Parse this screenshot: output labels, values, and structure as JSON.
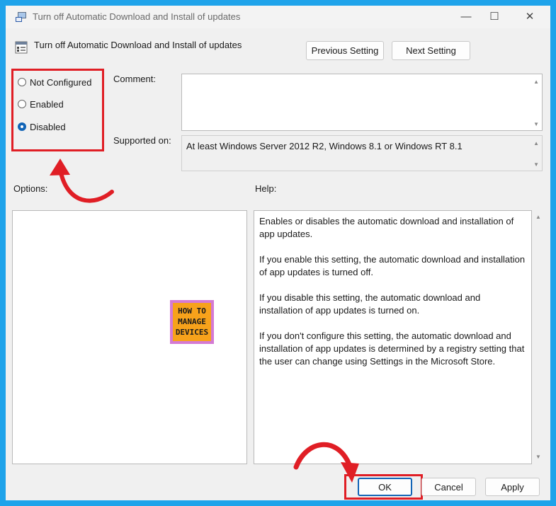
{
  "window": {
    "title": "Turn off Automatic Download and Install of updates",
    "controls": {
      "minimize": "—",
      "maximize": "☐",
      "close": "✕"
    }
  },
  "header": {
    "policy_name": "Turn off Automatic Download and Install of updates",
    "previous_label": "Previous Setting",
    "next_label": "Next Setting"
  },
  "state": {
    "options": [
      {
        "label": "Not Configured",
        "checked": false
      },
      {
        "label": "Enabled",
        "checked": false
      },
      {
        "label": "Disabled",
        "checked": true
      }
    ]
  },
  "comment": {
    "label": "Comment:",
    "value": ""
  },
  "supported": {
    "label": "Supported on:",
    "value": "At least Windows Server 2012 R2, Windows 8.1 or Windows RT 8.1"
  },
  "options_label": "Options:",
  "help": {
    "label": "Help:",
    "paragraphs": [
      "Enables or disables the automatic download and installation of app updates.",
      "If you enable this setting, the automatic download and installation of app updates is turned off.",
      "If you disable this setting, the automatic download and installation of app updates is turned on.",
      "If you don't configure this setting, the automatic download and installation of app updates is determined by a registry setting that the user can change using Settings in the Microsoft Store."
    ]
  },
  "logo": {
    "line1": "HOW TO",
    "line2": "MANAGE",
    "line3": "DEVICES"
  },
  "footer": {
    "ok_label": "OK",
    "cancel_label": "Cancel",
    "apply_label": "Apply"
  },
  "colors": {
    "frame": "#1fa3ea",
    "highlight": "#e01e25",
    "accent": "#1264b6"
  },
  "icons": {
    "window": "policy-icon",
    "header": "policy-setting-icon",
    "arrow": "curved-arrow-icon"
  }
}
